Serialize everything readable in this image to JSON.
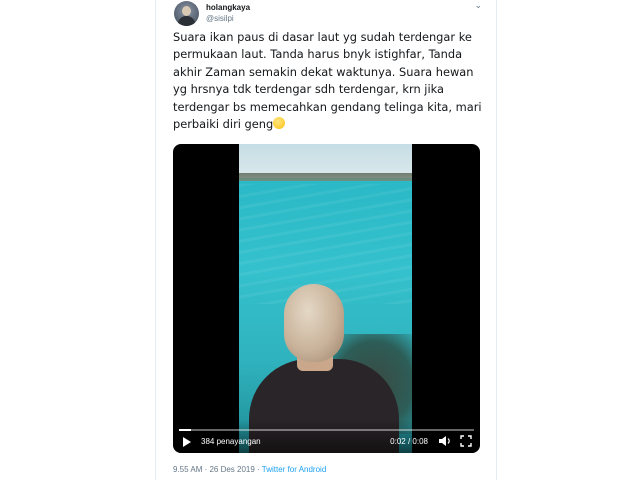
{
  "author": {
    "display_name": "holangkaya",
    "handle": "@sisilpi"
  },
  "tweet": {
    "text": "Suara ikan paus di dasar laut yg sudah terdengar ke permukaan laut. Tanda harus bnyk istighfar, Tanda akhir Zaman semakin dekat waktunya. Suara hewan yg hrsnya tdk terdengar sdh terdengar, krn jika terdengar bs memecahkan gendang telinga kita, mari perbaiki diri geng",
    "emoji_icon": "yellow-emoji-icon"
  },
  "video": {
    "views": "384 penayangan",
    "current_time": "0:02",
    "duration": "0:08",
    "progress_fraction": 0.04,
    "icons": {
      "play": "play-icon",
      "volume": "volume-icon",
      "fullscreen": "fullscreen-icon"
    }
  },
  "footer": {
    "timestamp": "9.55 AM · 26 Des 2019",
    "separator": " · ",
    "source": "Twitter for Android"
  },
  "colors": {
    "link": "#1da1f2",
    "secondary_text": "#657786",
    "primary_text": "#14171a"
  }
}
